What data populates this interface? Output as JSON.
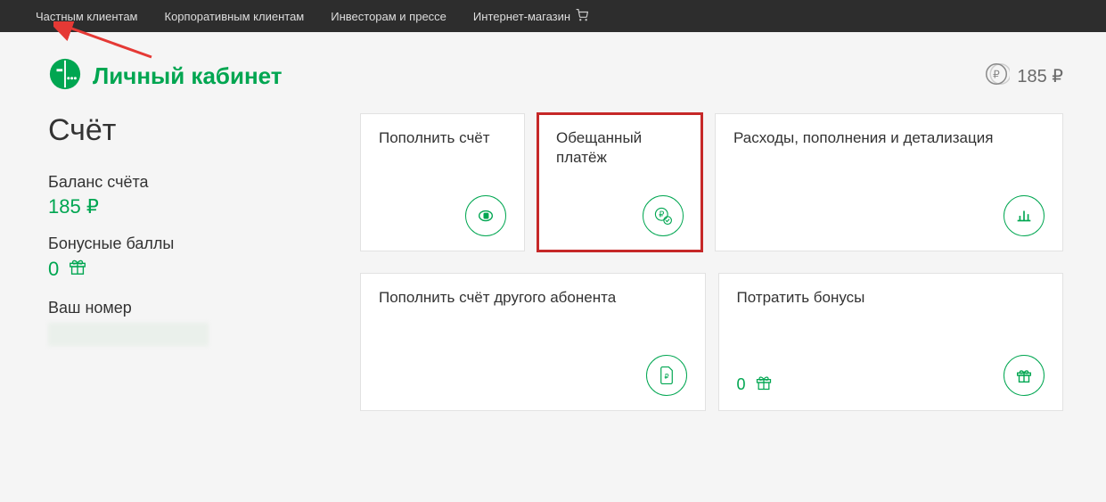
{
  "topnav": {
    "private": "Частным клиентам",
    "corporate": "Корпоративным клиентам",
    "investors": "Инвесторам и прессе",
    "shop": "Интернет-магазин"
  },
  "header": {
    "title": "Личный кабинет",
    "balance_display": "185 ₽"
  },
  "sidebar": {
    "section_title": "Счёт",
    "balance_label": "Баланс счёта",
    "balance_value": "185 ₽",
    "bonus_label": "Бонусные баллы",
    "bonus_value": "0",
    "phone_label": "Ваш номер"
  },
  "cards": {
    "topup": "Пополнить счёт",
    "promised": "Обещанный платёж",
    "expenses": "Расходы, пополнения и детализация",
    "topup_other": "Пополнить счёт другого абонента",
    "spend_bonus": "Потратить бонусы",
    "spend_bonus_value": "0"
  }
}
